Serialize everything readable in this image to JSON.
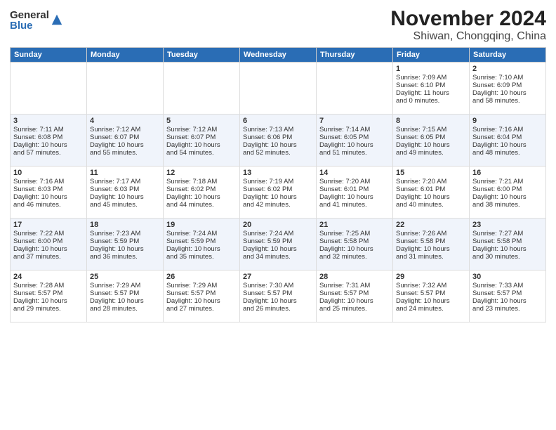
{
  "logo": {
    "general": "General",
    "blue": "Blue"
  },
  "title": "November 2024",
  "location": "Shiwan, Chongqing, China",
  "weekdays": [
    "Sunday",
    "Monday",
    "Tuesday",
    "Wednesday",
    "Thursday",
    "Friday",
    "Saturday"
  ],
  "weeks": [
    [
      {
        "day": "",
        "content": ""
      },
      {
        "day": "",
        "content": ""
      },
      {
        "day": "",
        "content": ""
      },
      {
        "day": "",
        "content": ""
      },
      {
        "day": "",
        "content": ""
      },
      {
        "day": "1",
        "content": "Sunrise: 7:09 AM\nSunset: 6:10 PM\nDaylight: 11 hours\nand 0 minutes."
      },
      {
        "day": "2",
        "content": "Sunrise: 7:10 AM\nSunset: 6:09 PM\nDaylight: 10 hours\nand 58 minutes."
      }
    ],
    [
      {
        "day": "3",
        "content": "Sunrise: 7:11 AM\nSunset: 6:08 PM\nDaylight: 10 hours\nand 57 minutes."
      },
      {
        "day": "4",
        "content": "Sunrise: 7:12 AM\nSunset: 6:07 PM\nDaylight: 10 hours\nand 55 minutes."
      },
      {
        "day": "5",
        "content": "Sunrise: 7:12 AM\nSunset: 6:07 PM\nDaylight: 10 hours\nand 54 minutes."
      },
      {
        "day": "6",
        "content": "Sunrise: 7:13 AM\nSunset: 6:06 PM\nDaylight: 10 hours\nand 52 minutes."
      },
      {
        "day": "7",
        "content": "Sunrise: 7:14 AM\nSunset: 6:05 PM\nDaylight: 10 hours\nand 51 minutes."
      },
      {
        "day": "8",
        "content": "Sunrise: 7:15 AM\nSunset: 6:05 PM\nDaylight: 10 hours\nand 49 minutes."
      },
      {
        "day": "9",
        "content": "Sunrise: 7:16 AM\nSunset: 6:04 PM\nDaylight: 10 hours\nand 48 minutes."
      }
    ],
    [
      {
        "day": "10",
        "content": "Sunrise: 7:16 AM\nSunset: 6:03 PM\nDaylight: 10 hours\nand 46 minutes."
      },
      {
        "day": "11",
        "content": "Sunrise: 7:17 AM\nSunset: 6:03 PM\nDaylight: 10 hours\nand 45 minutes."
      },
      {
        "day": "12",
        "content": "Sunrise: 7:18 AM\nSunset: 6:02 PM\nDaylight: 10 hours\nand 44 minutes."
      },
      {
        "day": "13",
        "content": "Sunrise: 7:19 AM\nSunset: 6:02 PM\nDaylight: 10 hours\nand 42 minutes."
      },
      {
        "day": "14",
        "content": "Sunrise: 7:20 AM\nSunset: 6:01 PM\nDaylight: 10 hours\nand 41 minutes."
      },
      {
        "day": "15",
        "content": "Sunrise: 7:20 AM\nSunset: 6:01 PM\nDaylight: 10 hours\nand 40 minutes."
      },
      {
        "day": "16",
        "content": "Sunrise: 7:21 AM\nSunset: 6:00 PM\nDaylight: 10 hours\nand 38 minutes."
      }
    ],
    [
      {
        "day": "17",
        "content": "Sunrise: 7:22 AM\nSunset: 6:00 PM\nDaylight: 10 hours\nand 37 minutes."
      },
      {
        "day": "18",
        "content": "Sunrise: 7:23 AM\nSunset: 5:59 PM\nDaylight: 10 hours\nand 36 minutes."
      },
      {
        "day": "19",
        "content": "Sunrise: 7:24 AM\nSunset: 5:59 PM\nDaylight: 10 hours\nand 35 minutes."
      },
      {
        "day": "20",
        "content": "Sunrise: 7:24 AM\nSunset: 5:59 PM\nDaylight: 10 hours\nand 34 minutes."
      },
      {
        "day": "21",
        "content": "Sunrise: 7:25 AM\nSunset: 5:58 PM\nDaylight: 10 hours\nand 32 minutes."
      },
      {
        "day": "22",
        "content": "Sunrise: 7:26 AM\nSunset: 5:58 PM\nDaylight: 10 hours\nand 31 minutes."
      },
      {
        "day": "23",
        "content": "Sunrise: 7:27 AM\nSunset: 5:58 PM\nDaylight: 10 hours\nand 30 minutes."
      }
    ],
    [
      {
        "day": "24",
        "content": "Sunrise: 7:28 AM\nSunset: 5:57 PM\nDaylight: 10 hours\nand 29 minutes."
      },
      {
        "day": "25",
        "content": "Sunrise: 7:29 AM\nSunset: 5:57 PM\nDaylight: 10 hours\nand 28 minutes."
      },
      {
        "day": "26",
        "content": "Sunrise: 7:29 AM\nSunset: 5:57 PM\nDaylight: 10 hours\nand 27 minutes."
      },
      {
        "day": "27",
        "content": "Sunrise: 7:30 AM\nSunset: 5:57 PM\nDaylight: 10 hours\nand 26 minutes."
      },
      {
        "day": "28",
        "content": "Sunrise: 7:31 AM\nSunset: 5:57 PM\nDaylight: 10 hours\nand 25 minutes."
      },
      {
        "day": "29",
        "content": "Sunrise: 7:32 AM\nSunset: 5:57 PM\nDaylight: 10 hours\nand 24 minutes."
      },
      {
        "day": "30",
        "content": "Sunrise: 7:33 AM\nSunset: 5:57 PM\nDaylight: 10 hours\nand 23 minutes."
      }
    ]
  ]
}
